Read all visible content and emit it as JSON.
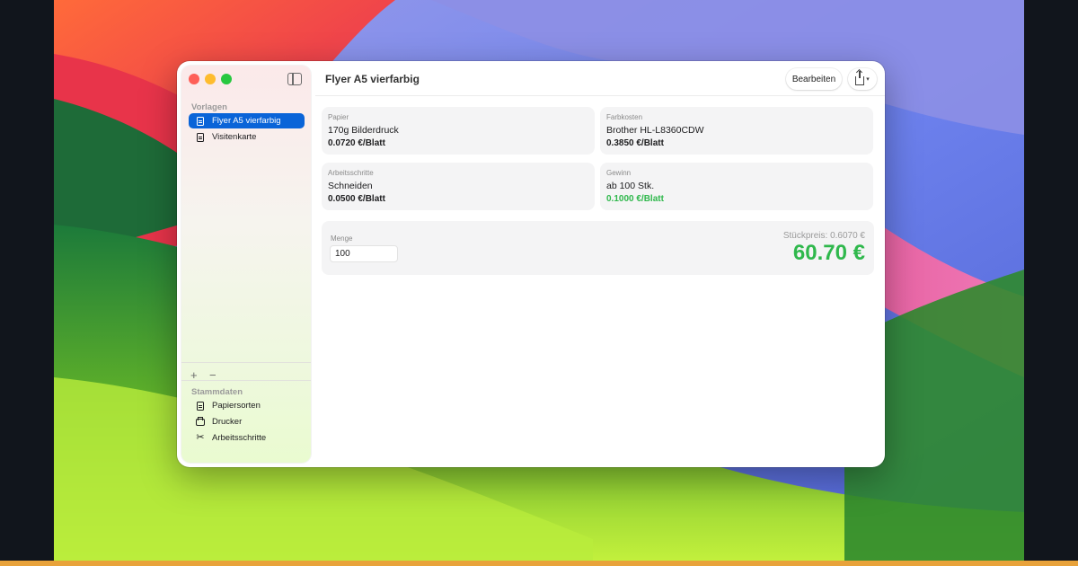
{
  "window": {
    "title": "Flyer A5 vierfarbig",
    "edit_label": "Bearbeiten"
  },
  "sidebar": {
    "section_templates": "Vorlagen",
    "templates": [
      {
        "label": "Flyer A5 vierfarbig",
        "icon": "document-icon",
        "active": true
      },
      {
        "label": "Visitenkarte",
        "icon": "document-icon",
        "active": false
      }
    ],
    "add_label": "+",
    "remove_label": "−",
    "section_master": "Stammdaten",
    "master": [
      {
        "label": "Papiersorten",
        "icon": "document-icon"
      },
      {
        "label": "Drucker",
        "icon": "printer-icon"
      },
      {
        "label": "Arbeitsschritte",
        "icon": "scissors-icon"
      }
    ]
  },
  "cards": {
    "paper": {
      "label": "Papier",
      "name": "170g Bilderdruck",
      "value": "0.0720 €/Blatt"
    },
    "ink": {
      "label": "Farbkosten",
      "name": "Brother HL-L8360CDW",
      "value": "0.3850 €/Blatt"
    },
    "steps": {
      "label": "Arbeitsschritte",
      "name": "Schneiden",
      "value": "0.0500 €/Blatt"
    },
    "profit": {
      "label": "Gewinn",
      "name": "ab 100 Stk.",
      "value": "0.1000 €/Blatt"
    }
  },
  "total": {
    "quantity_label": "Menge",
    "quantity_value": "100",
    "unit_price": "Stückpreis: 0.6070 €",
    "total_price": "60.70 €"
  },
  "colors": {
    "accent": "#0a64d8",
    "positive": "#2fb84c"
  }
}
